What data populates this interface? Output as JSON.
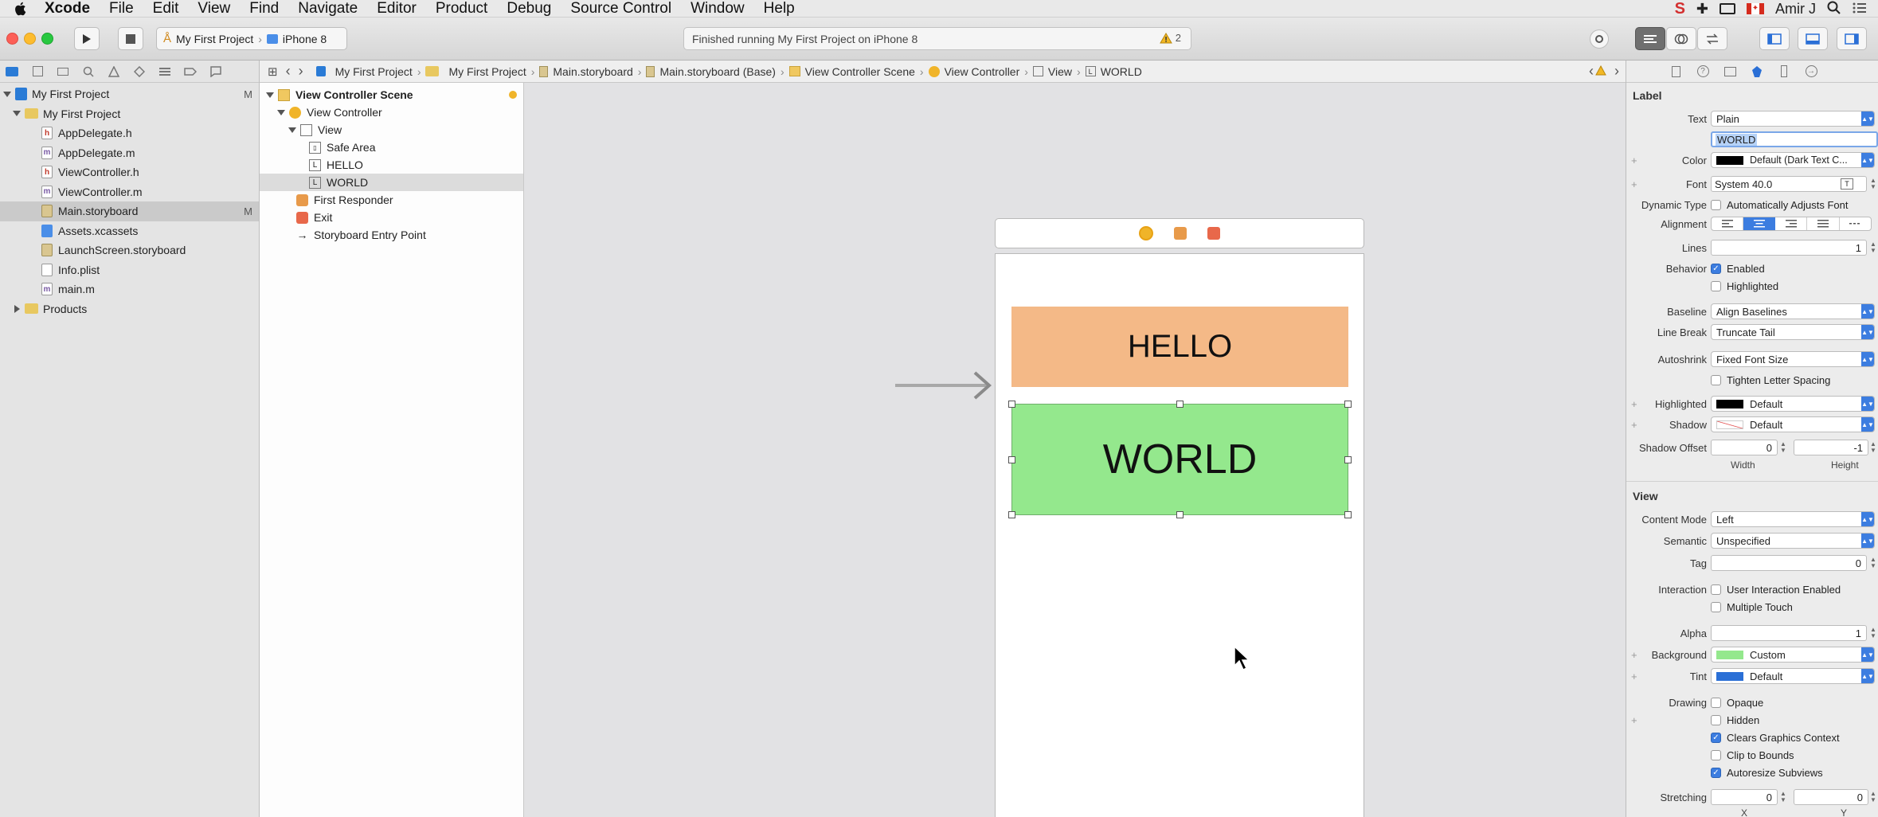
{
  "menubar": {
    "items": [
      "Xcode",
      "File",
      "Edit",
      "View",
      "Find",
      "Navigate",
      "Editor",
      "Product",
      "Debug",
      "Source Control",
      "Window",
      "Help"
    ],
    "user": "Amir J"
  },
  "toolbar": {
    "scheme_project": "My First Project",
    "scheme_device": "iPhone 8",
    "activity_status": "Finished running My First Project on iPhone 8",
    "warning_count": "2"
  },
  "navigator": {
    "project": "My First Project",
    "project_mark": "M",
    "group": "My First Project",
    "files": [
      {
        "name": "AppDelegate.h",
        "type": "h"
      },
      {
        "name": "AppDelegate.m",
        "type": "m"
      },
      {
        "name": "ViewController.h",
        "type": "h"
      },
      {
        "name": "ViewController.m",
        "type": "m"
      },
      {
        "name": "Main.storyboard",
        "type": "sb",
        "mark": "M"
      },
      {
        "name": "Assets.xcassets",
        "type": "assets"
      },
      {
        "name": "LaunchScreen.storyboard",
        "type": "sb"
      },
      {
        "name": "Info.plist",
        "type": "plist"
      },
      {
        "name": "main.m",
        "type": "m"
      }
    ],
    "products": "Products"
  },
  "jumpbar": {
    "crumbs": [
      "My First Project",
      "My First Project",
      "Main.storyboard",
      "Main.storyboard (Base)",
      "View Controller Scene",
      "View Controller",
      "View",
      "WORLD"
    ]
  },
  "outline": {
    "scene": "View Controller Scene",
    "view_controller": "View Controller",
    "view": "View",
    "safe_area": "Safe Area",
    "hello": "HELLO",
    "world": "WORLD",
    "first_responder": "First Responder",
    "exit": "Exit",
    "entry_point": "Storyboard Entry Point"
  },
  "canvas": {
    "hello_text": "HELLO",
    "world_text": "WORLD"
  },
  "inspector": {
    "label_section": "Label",
    "text_label": "Text",
    "text_value": "Plain",
    "text_content": "WORLD",
    "color_label": "Color",
    "color_value": "Default (Dark Text C...",
    "font_label": "Font",
    "font_value": "System 40.0",
    "dynamic_type_label": "Dynamic Type",
    "dynamic_type_option": "Automatically Adjusts Font",
    "alignment_label": "Alignment",
    "lines_label": "Lines",
    "lines_value": "1",
    "behavior_label": "Behavior",
    "behavior_enabled": "Enabled",
    "behavior_highlighted": "Highlighted",
    "baseline_label": "Baseline",
    "baseline_value": "Align Baselines",
    "line_break_label": "Line Break",
    "line_break_value": "Truncate Tail",
    "autoshrink_label": "Autoshrink",
    "autoshrink_value": "Fixed Font Size",
    "tighten_label": "Tighten Letter Spacing",
    "highlighted_label": "Highlighted",
    "highlighted_value": "Default",
    "shadow_label": "Shadow",
    "shadow_value": "Default",
    "shadow_offset_label": "Shadow Offset",
    "shadow_offset_width": "0",
    "shadow_offset_height": "-1",
    "width_label": "Width",
    "height_label": "Height",
    "view_section": "View",
    "content_mode_label": "Content Mode",
    "content_mode_value": "Left",
    "semantic_label": "Semantic",
    "semantic_value": "Unspecified",
    "tag_label": "Tag",
    "tag_value": "0",
    "interaction_label": "Interaction",
    "user_interaction": "User Interaction Enabled",
    "multiple_touch": "Multiple Touch",
    "alpha_label": "Alpha",
    "alpha_value": "1",
    "background_label": "Background",
    "background_value": "Custom",
    "tint_label": "Tint",
    "tint_value": "Default",
    "drawing_label": "Drawing",
    "opaque": "Opaque",
    "hidden": "Hidden",
    "clears_graphics": "Clears Graphics Context",
    "clip_to_bounds": "Clip to Bounds",
    "autoresize": "Autoresize Subviews",
    "stretching_label": "Stretching",
    "stretch_x": "0",
    "stretch_y": "0",
    "x_label": "X",
    "y_label": "Y"
  },
  "colors": {
    "hello_bg": "#f4b987",
    "world_bg": "#94e88d",
    "accent": "#3c7de0"
  }
}
